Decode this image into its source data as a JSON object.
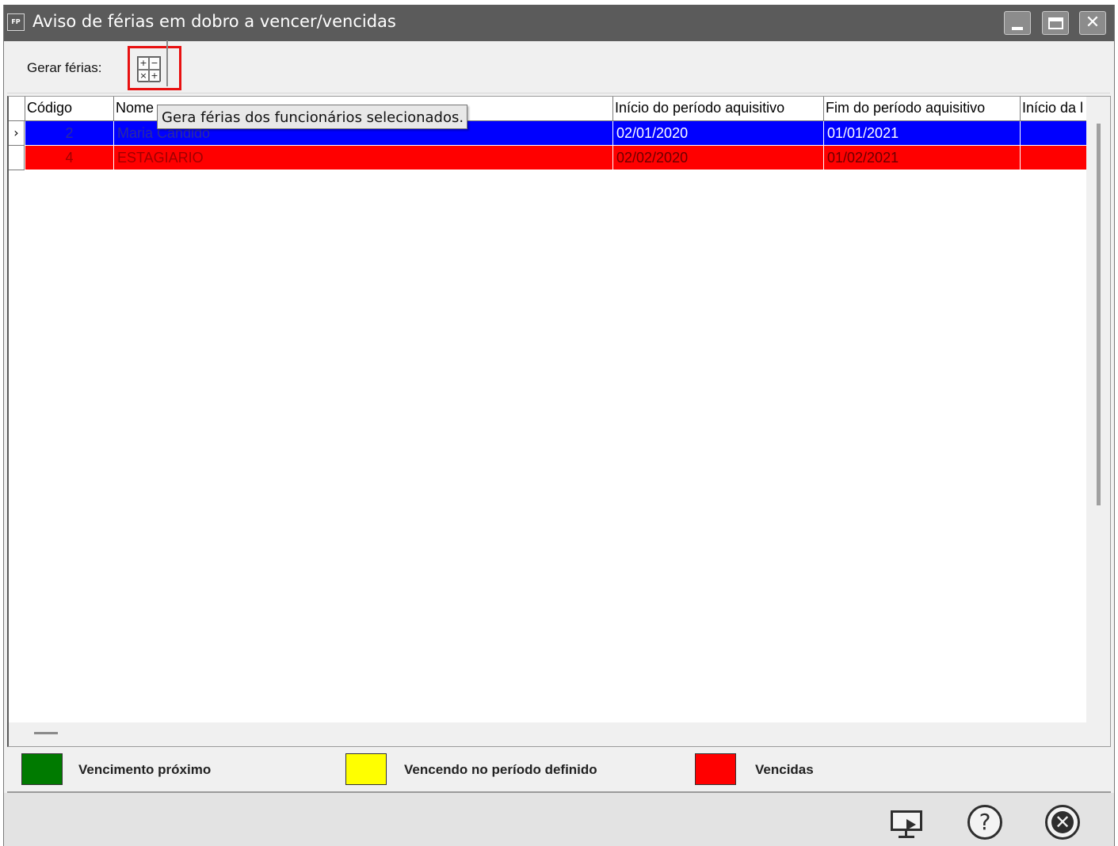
{
  "window": {
    "icon_text": "FP",
    "title": "Aviso de férias em dobro a vencer/vencidas"
  },
  "toolbar": {
    "gerar_label": "Gerar férias:",
    "calc_symbols": [
      "+",
      "−",
      "×",
      "+"
    ]
  },
  "tooltip": "Gera férias dos funcionários selecionados.",
  "table": {
    "columns": [
      "Código",
      "Nome",
      "Início do período aquisitivo",
      "Fim do período aquisitivo",
      "Início da l"
    ],
    "rows": [
      {
        "codigo": "2",
        "nome": "Maria Cândido",
        "inicio": "02/01/2020",
        "fim": "01/01/2021",
        "inicio_da": ""
      },
      {
        "codigo": "4",
        "nome": "ESTAGIARIO",
        "inicio": "02/02/2020",
        "fim": "01/02/2021",
        "inicio_da": ""
      }
    ],
    "row_colors": [
      "#0000ff",
      "#ff0000"
    ],
    "current_row_marker": "›"
  },
  "legend": [
    {
      "label": "Vencimento próximo",
      "color": "#007a00"
    },
    {
      "label": "Vencendo no período definido",
      "color": "#ffff00"
    },
    {
      "label": "Vencidas",
      "color": "#ff0000"
    }
  ],
  "footer": {
    "help_symbol": "?",
    "close_symbol": "✕"
  },
  "icons": {
    "app": "fp-app-icon",
    "calculator": "calculator-icon",
    "presentation": "presentation-icon",
    "help": "help-icon",
    "close": "close-icon"
  }
}
